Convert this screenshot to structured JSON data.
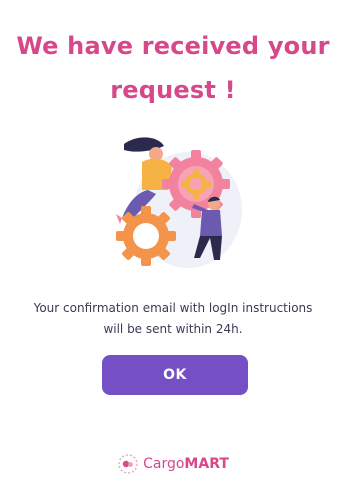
{
  "heading": {
    "line1": "We have received your",
    "line2": "request !"
  },
  "illustration": {
    "icon": "gears-illustration",
    "colors": {
      "gear_pink": "#f2829d",
      "gear_orange": "#f4934a",
      "gear_yellow": "#f6b245",
      "person_purple": "#6b5ab0",
      "person_dark": "#2b2a4c",
      "backdrop": "#eef1f7"
    }
  },
  "message": {
    "line1": "Your confirmation email with logIn instructions",
    "line2": "will be sent within 24h."
  },
  "actions": {
    "ok_label": "OK",
    "ok_color": "#744fc6"
  },
  "brand": {
    "name_part1": "Cargo",
    "name_part2": "MART",
    "color": "#d6488a",
    "icon": "cargomart-logo-icon"
  }
}
